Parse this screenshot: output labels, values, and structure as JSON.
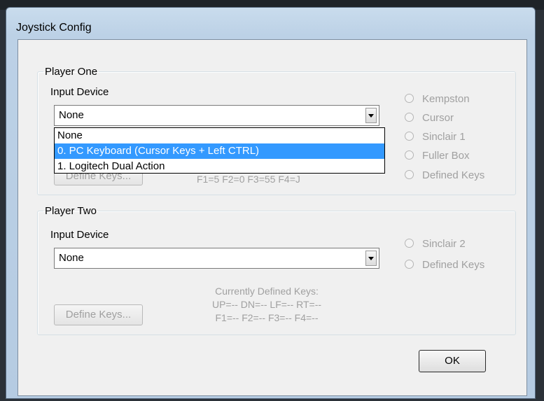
{
  "window": {
    "title": "Joystick Config"
  },
  "player_one": {
    "legend": "Player One",
    "input_label": "Input Device",
    "device_value": "None",
    "dropdown_options": [
      "None",
      "0. PC Keyboard (Cursor Keys + Left CTRL)",
      "1. Logitech Dual Action"
    ],
    "selected_option_index": 1,
    "define_button": "Define Keys...",
    "keys_text": "F1=5  F2=0  F3=55  F4=J",
    "radios": [
      "Kempston",
      "Cursor",
      "Sinclair 1",
      "Fuller Box",
      "Defined Keys"
    ]
  },
  "player_two": {
    "legend": "Player Two",
    "input_label": "Input Device",
    "device_value": "None",
    "define_button": "Define Keys...",
    "keys_title": "Currently Defined Keys:",
    "keys_line1": "UP=--  DN=--  LF=--  RT=--",
    "keys_line2": "F1=--  F2=--  F3=--  F4=--",
    "radios": [
      "Sinclair 2",
      "Defined Keys"
    ]
  },
  "footer": {
    "ok_button": "OK"
  },
  "colors": {
    "selection": "#3399ff",
    "disabled_text": "#a0a0a0"
  }
}
